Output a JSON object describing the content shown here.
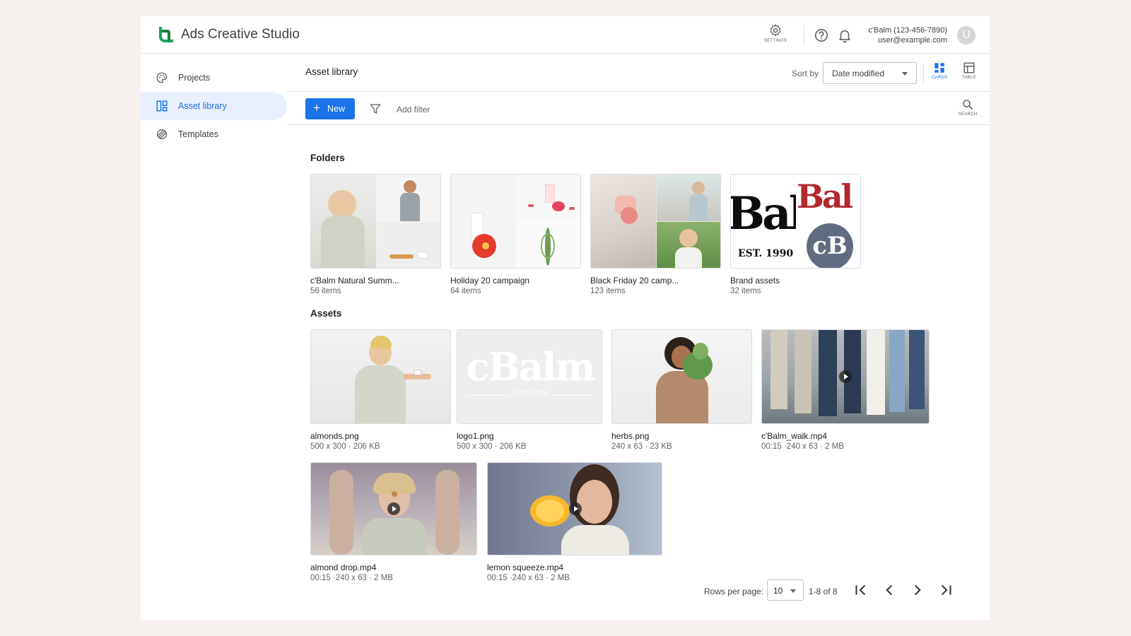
{
  "app": {
    "title": "Ads Creative Studio",
    "accent": "#1a73e8",
    "brand_color": "#1aa260"
  },
  "header": {
    "settings_label": "SETTINGS",
    "account_name": "c'Balm (123-456-7890)",
    "account_email": "user@example.com",
    "avatar_letter": "U"
  },
  "sidebar": {
    "items": [
      {
        "label": "Projects",
        "icon": "palette-icon",
        "active": false
      },
      {
        "label": "Asset library",
        "icon": "dashboard-icon",
        "active": true
      },
      {
        "label": "Templates",
        "icon": "templates-icon",
        "active": false
      }
    ]
  },
  "main": {
    "title": "Asset library",
    "sort_label": "Sort by",
    "sort_value": "Date modified",
    "view_cards_label": "CARDS",
    "view_table_label": "TABLE",
    "new_label": "New",
    "add_filter_label": "Add filter",
    "search_label": "SEARCH"
  },
  "folders": {
    "title": "Folders",
    "items": [
      {
        "name": "c'Balm Natural Summ...",
        "meta": "56 items"
      },
      {
        "name": "Holiday 20 campaign",
        "meta": "64 items"
      },
      {
        "name": "Black Friday 20 camp...",
        "meta": "123 items"
      },
      {
        "name": "Brand assets",
        "meta": "32 items"
      }
    ],
    "brand_tile": {
      "left_text": "Bal",
      "right_text": "Bal",
      "est_text": "EST. 1990",
      "monogram": "cB"
    }
  },
  "assets": {
    "title": "Assets",
    "items": [
      {
        "name": "almonds.png",
        "meta": "500 x 300 · 206 KB",
        "video": false
      },
      {
        "name": "logo1.png",
        "meta": "500 x 300 · 206 KB",
        "video": false
      },
      {
        "name": "herbs.png",
        "meta": "240 x 63 · 23 KB",
        "video": false
      },
      {
        "name": "c'Balm_walk.mp4",
        "meta": "00:15 ·240 x 63 · 2 MB",
        "video": true
      },
      {
        "name": "almond drop.mp4",
        "meta": "00:15 ·240 x 63 · 2 MB",
        "video": true
      },
      {
        "name": "lemon squeeze.mp4",
        "meta": "00:15 ·240 x 63 · 2 MB",
        "video": true
      }
    ],
    "logo_tile_text": "cBalm",
    "logo_tile_sub": "EST. 1990"
  },
  "pagination": {
    "rows_label": "Rows per page:",
    "rows_value": "10",
    "range": "1-8 of 8"
  }
}
